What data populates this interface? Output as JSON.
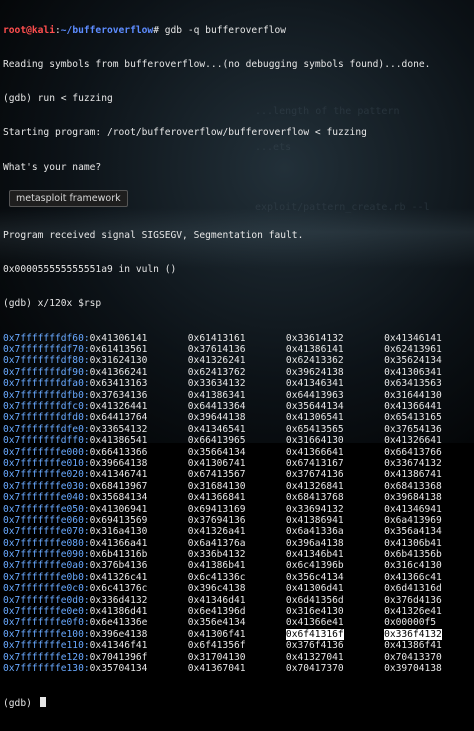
{
  "terminal": {
    "prompt_user": "root@kali",
    "prompt_sep": ":",
    "prompt_path": "~/bufferoverflow",
    "prompt_symbol": "# ",
    "prompt_cmd": "gdb -q bufferoverflow",
    "header_lines": [
      "Reading symbols from bufferoverflow...(no debugging symbols found)...done.",
      "(gdb) run < fuzzing",
      "Starting program: /root/bufferoverflow/bufferoverflow < fuzzing",
      "What's your name?",
      "",
      "Program received signal SIGSEGV, Segmentation fault.",
      "0x000055555555551a9 in vuln ()",
      "(gdb) x/120x $rsp"
    ],
    "ghost_text": [
      "...length of the pattern",
      "...ets",
      "",
      "exploit/pattern_create.rb --l"
    ],
    "tooltip": "metasploit framework",
    "final_prompt": "(gdb) "
  },
  "memory_rows": [
    {
      "addr": "0x7fffffffdf60:",
      "v": [
        "0x41306141",
        "0x61413161",
        "0x33614132",
        "0x41346141"
      ]
    },
    {
      "addr": "0x7fffffffdf70:",
      "v": [
        "0x61413561",
        "0x37614136",
        "0x41386141",
        "0x62413961"
      ]
    },
    {
      "addr": "0x7fffffffdf80:",
      "v": [
        "0x31624130",
        "0x41326241",
        "0x62413362",
        "0x35624134"
      ]
    },
    {
      "addr": "0x7fffffffdf90:",
      "v": [
        "0x41366241",
        "0x62413762",
        "0x39624138",
        "0x41306341"
      ]
    },
    {
      "addr": "0x7fffffffdfa0:",
      "v": [
        "0x63413163",
        "0x33634132",
        "0x41346341",
        "0x63413563"
      ]
    },
    {
      "addr": "0x7fffffffdfb0:",
      "v": [
        "0x37634136",
        "0x41386341",
        "0x64413963",
        "0x31644130"
      ]
    },
    {
      "addr": "0x7fffffffdfc0:",
      "v": [
        "0x41326441",
        "0x64413364",
        "0x35644134",
        "0x41366441"
      ]
    },
    {
      "addr": "0x7fffffffdfd0:",
      "v": [
        "0x64413764",
        "0x39644138",
        "0x41306541",
        "0x65413165"
      ]
    },
    {
      "addr": "0x7fffffffdfe0:",
      "v": [
        "0x33654132",
        "0x41346541",
        "0x65413565",
        "0x37654136"
      ]
    },
    {
      "addr": "0x7fffffffdff0:",
      "v": [
        "0x41386541",
        "0x66413965",
        "0x31664130",
        "0x41326641"
      ]
    },
    {
      "addr": "0x7fffffffe000:",
      "v": [
        "0x66413366",
        "0x35664134",
        "0x41366641",
        "0x66413766"
      ]
    },
    {
      "addr": "0x7fffffffe010:",
      "v": [
        "0x39664138",
        "0x41306741",
        "0x67413167",
        "0x33674132"
      ]
    },
    {
      "addr": "0x7fffffffe020:",
      "v": [
        "0x41346741",
        "0x67413567",
        "0x37674136",
        "0x41386741"
      ]
    },
    {
      "addr": "0x7fffffffe030:",
      "v": [
        "0x68413967",
        "0x31684130",
        "0x41326841",
        "0x68413368"
      ]
    },
    {
      "addr": "0x7fffffffe040:",
      "v": [
        "0x35684134",
        "0x41366841",
        "0x68413768",
        "0x39684138"
      ]
    },
    {
      "addr": "0x7fffffffe050:",
      "v": [
        "0x41306941",
        "0x69413169",
        "0x33694132",
        "0x41346941"
      ]
    },
    {
      "addr": "0x7fffffffe060:",
      "v": [
        "0x69413569",
        "0x37694136",
        "0x41386941",
        "0x6a413969"
      ]
    },
    {
      "addr": "0x7fffffffe070:",
      "v": [
        "0x316a4130",
        "0x41326a41",
        "0x6a41336a",
        "0x356a4134"
      ]
    },
    {
      "addr": "0x7fffffffe080:",
      "v": [
        "0x41366a41",
        "0x6a41376a",
        "0x396a4138",
        "0x41306b41"
      ]
    },
    {
      "addr": "0x7fffffffe090:",
      "v": [
        "0x6b41316b",
        "0x336b4132",
        "0x41346b41",
        "0x6b41356b"
      ]
    },
    {
      "addr": "0x7fffffffe0a0:",
      "v": [
        "0x376b4136",
        "0x41386b41",
        "0x6c41396b",
        "0x316c4130"
      ]
    },
    {
      "addr": "0x7fffffffe0b0:",
      "v": [
        "0x41326c41",
        "0x6c41336c",
        "0x356c4134",
        "0x41366c41"
      ]
    },
    {
      "addr": "0x7fffffffe0c0:",
      "v": [
        "0x6c41376c",
        "0x396c4138",
        "0x41306d41",
        "0x6d41316d"
      ]
    },
    {
      "addr": "0x7fffffffe0d0:",
      "v": [
        "0x336d4132",
        "0x41346d41",
        "0x6d41356d",
        "0x376d4136"
      ]
    },
    {
      "addr": "0x7fffffffe0e0:",
      "v": [
        "0x41386d41",
        "0x6e41396d",
        "0x316e4130",
        "0x41326e41"
      ]
    },
    {
      "addr": "0x7fffffffe0f0:",
      "v": [
        "0x6e41336e",
        "0x356e4134",
        "0x41366e41",
        "0x00000f5"
      ]
    },
    {
      "addr": "0x7fffffffe100:",
      "v": [
        "0x396e4138",
        "0x41306f41",
        "0x6f41316f",
        "0x336f4132"
      ]
    },
    {
      "addr": "0x7fffffffe110:",
      "v": [
        "0x41346f41",
        "0x6f41356f",
        "0x376f4136",
        "0x41386f41"
      ]
    },
    {
      "addr": "0x7fffffffe120:",
      "v": [
        "0x7041396f",
        "0x31704130",
        "0x41327041",
        "0x70413370"
      ]
    },
    {
      "addr": "0x7fffffffe130:",
      "v": [
        "0x35704134",
        "0x41367041",
        "0x70417370",
        "0x39704138"
      ]
    }
  ],
  "highlighted_cells": [
    "0x6f41316f",
    "0x336f4132"
  ]
}
